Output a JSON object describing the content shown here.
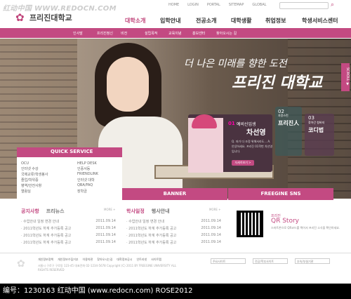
{
  "watermark_top": "红动中国 WWW.REDOCN.COM",
  "util": [
    "HOME",
    "LOGIN",
    "PORTAL",
    "SITEMAP",
    "GLOBAL"
  ],
  "logo": "프리진대학교",
  "gnb": [
    "대학소개",
    "입학안내",
    "전공소개",
    "대학생활",
    "취업정보",
    "학생서비스센터"
  ],
  "subnav": [
    "인사말",
    "프리진정신",
    "비전",
    "설립목적",
    "교육이념",
    "홍보센터",
    "찾아오시는 길"
  ],
  "hero": {
    "line1": "더 나은 미래를 향한 도전",
    "line2": "프리진 대학교",
    "scroll_tab": "SCROLL ▼"
  },
  "card1": {
    "num": "01",
    "sub": "예비신입생",
    "name": "차선영",
    "desc": "Q. 저가 다 조정 위해서라도... A. 안녕하세요. 프리진 01학번 차선영 입니다.",
    "btn": "자세히보기 >"
  },
  "card2": {
    "num": "02",
    "txt": "자랑스런",
    "name": "프리진人"
  },
  "card3": {
    "num": "03",
    "txt": "찾아간 청바지",
    "name": "코디법"
  },
  "quick": {
    "title": "QUICK SERVICE",
    "items": [
      "OCU",
      "HELP DESK",
      "인터넷 수강",
      "인증서등",
      "국제교류/학생봉사",
      "FRIENDLINK",
      "졸업/학위증",
      "인터넷 대학",
      "병역/안전사항",
      "QBA/FAQ",
      "열람실",
      "장학금"
    ]
  },
  "banner": "BANNER",
  "sns": "FREEGINE SNS",
  "news1": {
    "tabs": [
      "공지사항",
      "프리뉴스"
    ],
    "more": "MORE +",
    "rows": [
      {
        "t": "· 수업안내 일정 변경 안내",
        "d": "2011.09.14"
      },
      {
        "t": "· 2011학년도 하계 추가등록 공고",
        "d": "2011.09.14"
      },
      {
        "t": "· 2011학년도 하계 추가등록 공고",
        "d": "2011.09.14"
      },
      {
        "t": "· 2011학년도 하계 추가등록 공고",
        "d": "2011.09.14"
      }
    ]
  },
  "news2": {
    "tabs": [
      "학사일정",
      "행사안내"
    ],
    "more": "MORE +",
    "rows": [
      {
        "t": "· 수업안내 일정 변경 안내",
        "d": "2011.09.14"
      },
      {
        "t": "· 2011학년도 하계 추가등록 공고",
        "d": "2011.09.14"
      },
      {
        "t": "· 2011학년도 하계 추가등록 공고",
        "d": "2011.09.14"
      },
      {
        "t": "· 2011학년도 하계 추가등록 공고",
        "d": "2011.09.14"
      }
    ]
  },
  "qr": {
    "sub": "프리진",
    "title": "QR Story",
    "desc": "스마트폰으로 QR코드를 찍어서 프리진 소식을 확인하세요."
  },
  "footer": {
    "links": [
      "개인정보정책",
      "개인정보수집거부",
      "이용약관",
      "찾아오시는길",
      "대학정보공시",
      "인트라넷",
      "사이트맵"
    ],
    "addr": "서울시 구로구 구로동 123-45 대표전화 02-1234-5678  Copyright (C) 2011 BY FREEGINE UNIVERSITY ALL RIGHTS RESERVED",
    "selects": [
      "주요사이트",
      "전공/학부사이트",
      "부속/부설기관"
    ]
  },
  "bottom_bar": "编号：1230163  红动中国 (www.redocn.com)   ROSE2012",
  "accent": "#c34a82"
}
